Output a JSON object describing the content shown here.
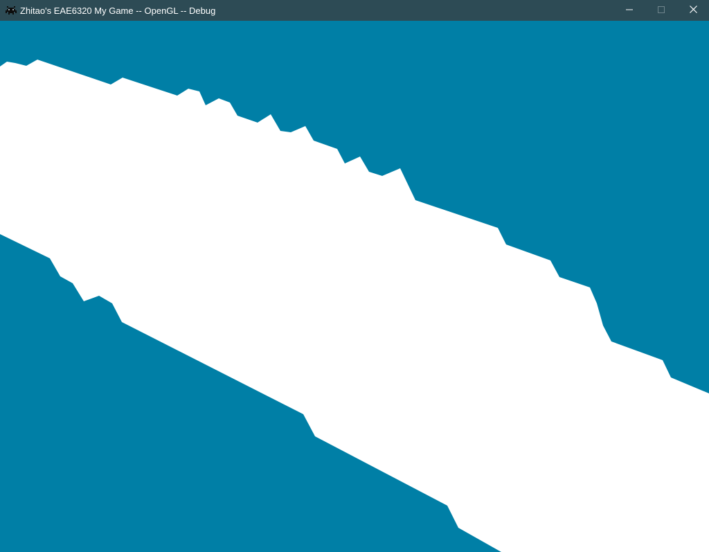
{
  "window": {
    "title": "Zhitao's EAE6320 My Game -- OpenGL -- Debug",
    "icon": "space-invader-icon",
    "controls": {
      "minimize_icon": "minimize-icon",
      "maximize_icon": "maximize-icon",
      "close_icon": "close-icon"
    }
  },
  "scene": {
    "clear_color": "#007fa6",
    "mesh_color": "#ffffff",
    "titlebar_color": "#2d4b55"
  }
}
